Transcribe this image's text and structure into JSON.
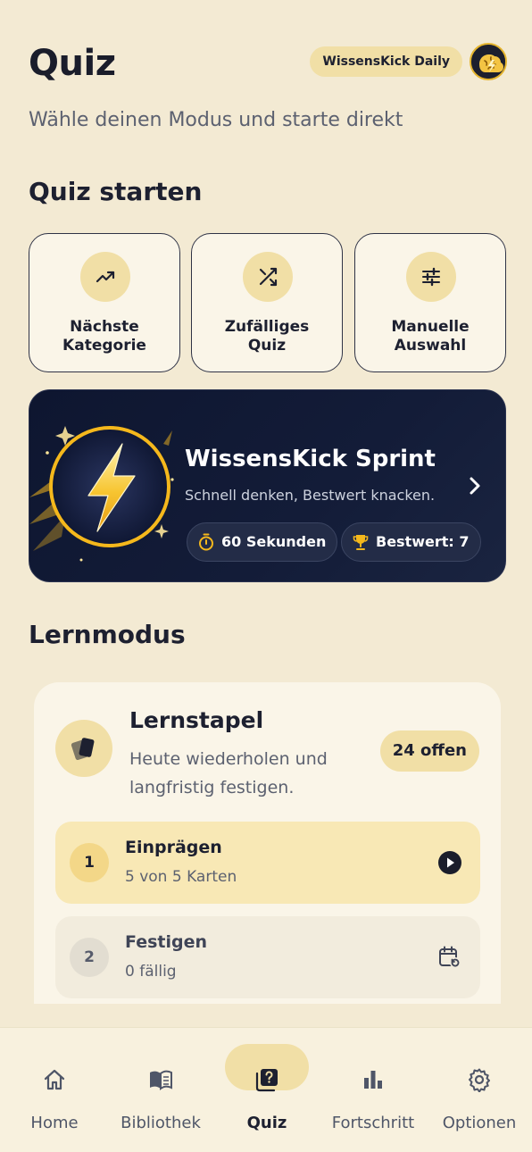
{
  "header": {
    "title": "Quiz",
    "daily_label": "WissensKick Daily",
    "subtitle": "Wähle deinen Modus und starte direkt"
  },
  "start_section": {
    "title": "Quiz starten",
    "tiles": [
      {
        "label": "Nächste\nKategorie",
        "icon": "trending-up-icon"
      },
      {
        "label": "Zufälliges\nQuiz",
        "icon": "shuffle-icon"
      },
      {
        "label": "Manuelle\nAuswahl",
        "icon": "sliders-icon"
      }
    ]
  },
  "sprint": {
    "title": "WissensKick Sprint",
    "subtitle": "Schnell denken, Bestwert knacken.",
    "time_chip": "60 Sekunden",
    "best_chip": "Bestwert: 7"
  },
  "learn_section": {
    "title": "Lernmodus",
    "deck": {
      "title": "Lernstapel",
      "subtitle": "Heute wiederholen und langfristig festigen.",
      "badge": "24 offen"
    },
    "steps": [
      {
        "number": "1",
        "title": "Einprägen",
        "subtitle": "5 von 5 Karten",
        "action_icon": "play-icon"
      },
      {
        "number": "2",
        "title": "Festigen",
        "subtitle": "0 fällig",
        "action_icon": "calendar-refresh-icon"
      }
    ]
  },
  "tabbar": {
    "tabs": [
      {
        "label": "Home",
        "icon": "home-icon"
      },
      {
        "label": "Bibliothek",
        "icon": "book-icon"
      },
      {
        "label": "Quiz",
        "icon": "quiz-icon",
        "selected": true
      },
      {
        "label": "Fortschritt",
        "icon": "bar-chart-icon"
      },
      {
        "label": "Optionen",
        "icon": "gear-icon"
      }
    ]
  },
  "colors": {
    "background": "#f3ead3",
    "accent": "#f1dfa6",
    "card": "#faf5e8",
    "dark_card": "#0e1630",
    "gold": "#f5b81c"
  }
}
